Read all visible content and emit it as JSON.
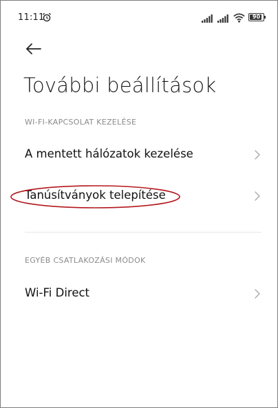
{
  "status_bar": {
    "time": "11:11",
    "battery_level": "90",
    "battery_fraction": 0.9
  },
  "header": {
    "back_icon": "arrow-left-icon",
    "title": "További beállítások"
  },
  "sections": [
    {
      "header": "WI-FI-KAPCSOLAT KEZELÉSE",
      "items": [
        {
          "label": "A mentett hálózatok kezelése",
          "icon": "chevron-right-icon"
        },
        {
          "label": "Tanúsítványok telepítése",
          "icon": "chevron-right-icon",
          "highlighted": true
        }
      ]
    },
    {
      "header": "EGYÉB CSATLAKOZÁSI MÓDOK",
      "items": [
        {
          "label": "Wi-Fi Direct",
          "icon": "chevron-right-icon"
        }
      ]
    }
  ],
  "colors": {
    "highlight_oval": "#b3161c",
    "section_header": "#8a8a8a",
    "chevron": "#a8a8a8"
  }
}
